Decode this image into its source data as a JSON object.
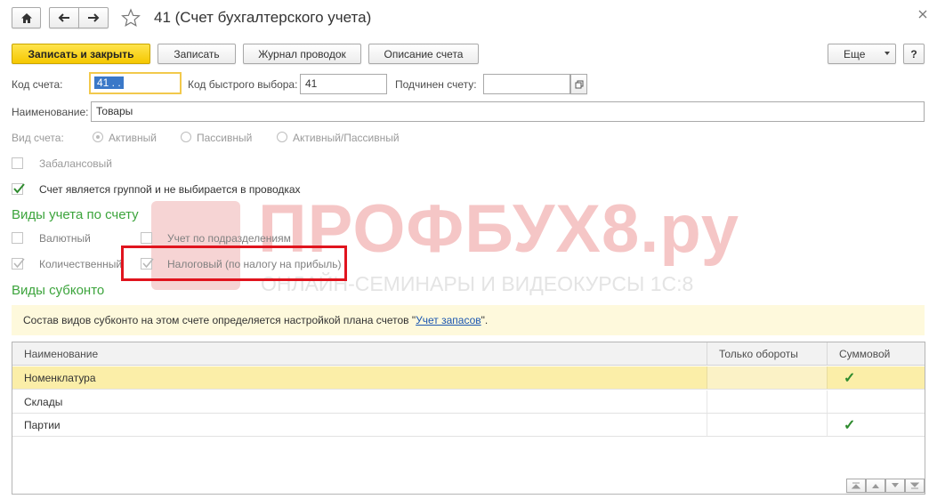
{
  "window": {
    "title": "41 (Счет бухгалтерского учета)",
    "home_icon": "home-icon",
    "back_icon": "arrow-left-icon",
    "forward_icon": "arrow-right-icon",
    "favorite_icon": "star-icon",
    "close_icon": "close-icon"
  },
  "toolbar": {
    "save_close": "Записать и закрыть",
    "save": "Записать",
    "journal": "Журнал проводок",
    "description": "Описание счета",
    "more": "Еще",
    "help": "?"
  },
  "form": {
    "code_label": "Код счета:",
    "code_value": "41 . .",
    "quick_label": "Код быстрого выбора:",
    "quick_value": "41",
    "parent_label": "Подчинен счету:",
    "parent_value": "",
    "name_label": "Наименование:",
    "name_value": "Товары",
    "type_label": "Вид счета:",
    "type_options": [
      "Активный",
      "Пассивный",
      "Активный/Пассивный"
    ],
    "offbalance_label": "Забалансовый",
    "is_group_label": "Счет является группой и не выбирается в проводках"
  },
  "accounting": {
    "heading": "Виды учета по счету",
    "currency": "Валютный",
    "subdivisions": "Учет по подразделениям",
    "quantitative": "Количественный",
    "tax": "Налоговый (по налогу на прибыль)"
  },
  "subconto": {
    "heading": "Виды субконто",
    "info_text": "Состав видов субконто на этом счете определяется настройкой плана счетов \"",
    "info_link": "Учет запасов",
    "info_tail": "\".",
    "columns": [
      "Наименование",
      "Только обороты",
      "Суммовой"
    ],
    "rows": [
      {
        "name": "Номенклатура",
        "turnover_only": "",
        "sum": "✓"
      },
      {
        "name": "Склады",
        "turnover_only": "",
        "sum": ""
      },
      {
        "name": "Партии",
        "turnover_only": "",
        "sum": "✓"
      }
    ]
  },
  "watermark": {
    "title": "ПРОФБУХ8.ру",
    "subtitle": "ОНЛАЙН-СЕМИНАРЫ И ВИДЕОКУРСЫ 1С:8"
  },
  "colors": {
    "accent_green": "#3ca43c",
    "primary_yellow": "#f5c800",
    "highlight_red": "#e0141e",
    "row_selected": "#fbeea8"
  }
}
